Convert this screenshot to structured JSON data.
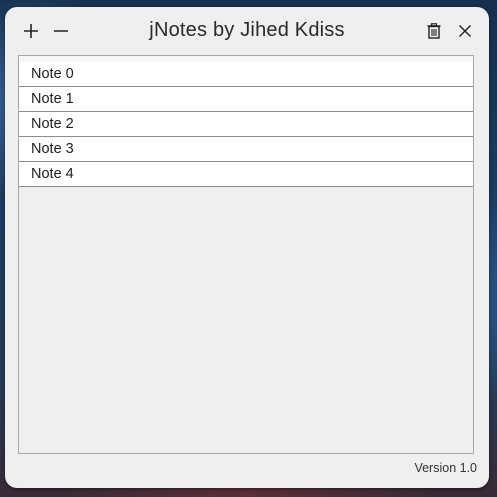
{
  "window": {
    "title": "jNotes by Jihed Kdiss",
    "version": "Version 1.0"
  },
  "toolbar": {
    "add_icon": "plus-icon",
    "remove_icon": "minus-icon",
    "delete_icon": "trash-icon",
    "close_icon": "close-icon"
  },
  "notes": [
    {
      "label": "Note 0"
    },
    {
      "label": "Note 1"
    },
    {
      "label": "Note 2"
    },
    {
      "label": "Note 3"
    },
    {
      "label": "Note 4"
    }
  ],
  "colors": {
    "window_bg": "#efefef",
    "item_bg": "#ffffff",
    "text": "#2a2a2a"
  }
}
